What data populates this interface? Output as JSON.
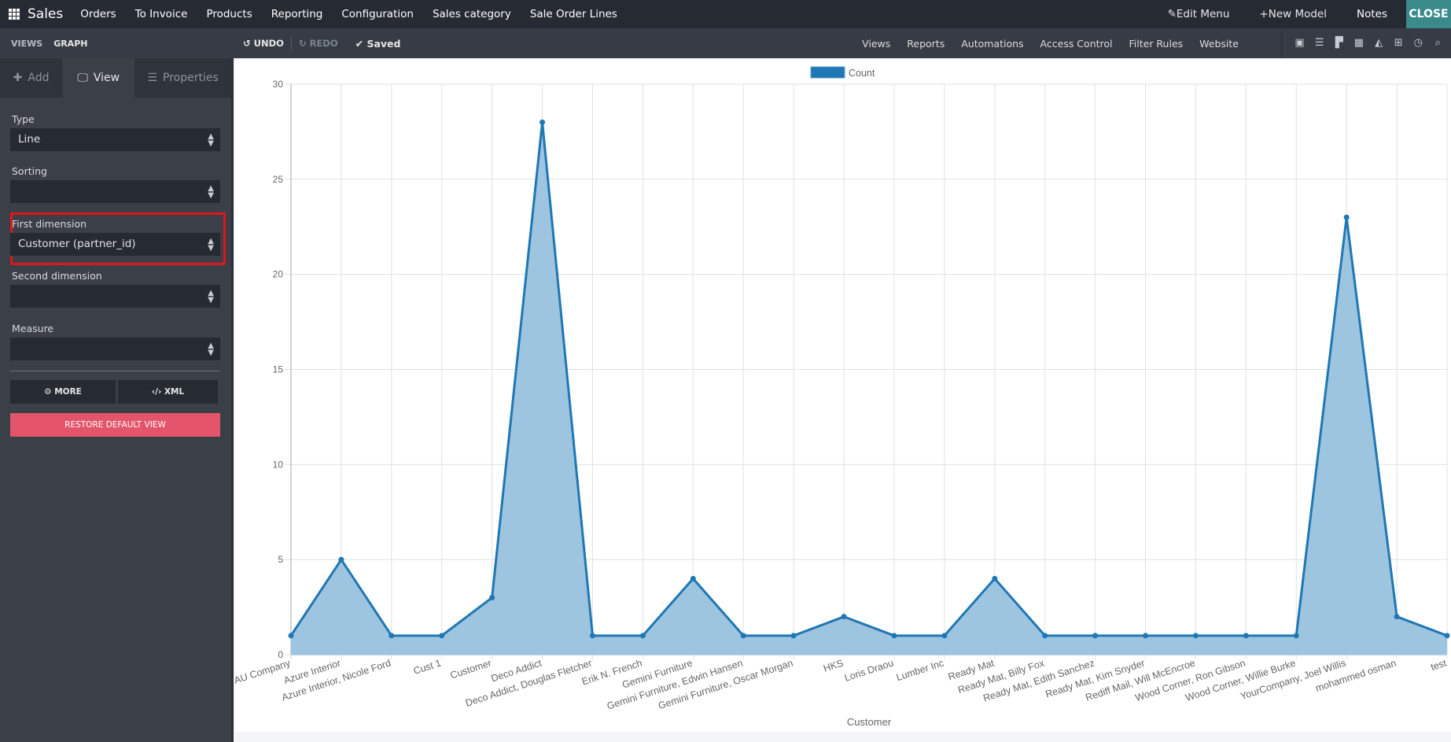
{
  "topbar": {
    "app_name": "Sales",
    "menu": [
      "Orders",
      "To Invoice",
      "Products",
      "Reporting",
      "Configuration",
      "Sales category",
      "Sale Order Lines"
    ],
    "edit_menu": "Edit Menu",
    "new_model": "New Model",
    "notes": "Notes",
    "close": "CLOSE"
  },
  "subbar": {
    "breadcrumb": [
      "VIEWS",
      "GRAPH"
    ],
    "undo": "UNDO",
    "redo": "REDO",
    "saved": "Saved",
    "links": [
      "Views",
      "Reports",
      "Automations",
      "Access Control",
      "Filter Rules",
      "Website"
    ],
    "view_icons": [
      "form-view-icon",
      "list-view-icon",
      "kanban-view-icon",
      "calendar-view-icon",
      "graph-view-icon",
      "pivot-view-icon",
      "activity-view-icon",
      "search-view-icon"
    ]
  },
  "sidebar": {
    "tabs": [
      {
        "label": "Add",
        "icon": "plus-icon"
      },
      {
        "label": "View",
        "icon": "monitor-icon",
        "active": true
      },
      {
        "label": "Properties",
        "icon": "server-icon"
      }
    ],
    "fields": {
      "type": {
        "label": "Type",
        "value": "Line"
      },
      "sorting": {
        "label": "Sorting",
        "value": ""
      },
      "first_dimension": {
        "label": "First dimension",
        "value": "Customer (partner_id)"
      },
      "second_dimension": {
        "label": "Second dimension",
        "value": ""
      },
      "measure": {
        "label": "Measure",
        "value": ""
      }
    },
    "more": "MORE",
    "xml": "XML",
    "restore": "RESTORE DEFAULT VIEW"
  },
  "colors": {
    "line": "#1f77b4",
    "fill": "#9ec5e0",
    "highlight": "#e0161c",
    "restore_button": "#e4546a",
    "close_button": "#3a8a8c"
  },
  "chart_data": {
    "type": "line",
    "title": "",
    "legend": {
      "entries": [
        "Count"
      ],
      "position": "top-center"
    },
    "xlabel": "Customer",
    "ylabel": "",
    "ylim": [
      0,
      30
    ],
    "yticks": [
      0,
      5,
      10,
      15,
      20,
      25,
      30
    ],
    "grid": true,
    "filled": true,
    "categories": [
      "AU Company",
      "Azure Interior",
      "Azure Interior, Nicole Ford",
      "Cust 1",
      "Customer",
      "Deco Addict",
      "Deco Addict, Douglas Fletcher",
      "Erik N. French",
      "Gemini Furniture",
      "Gemini Furniture, Edwin Hansen",
      "Gemini Furniture, Oscar Morgan",
      "HKS",
      "Loris Draou",
      "Lumber Inc",
      "Ready Mat",
      "Ready Mat, Billy Fox",
      "Ready Mat, Edith Sanchez",
      "Ready Mat, Kim Snyder",
      "Rediff Mail, Will McEncroe",
      "Wood Corner, Ron Gibson",
      "Wood Corner, Willie Burke",
      "YourCompany, Joel Willis",
      "mohammed osman",
      "test"
    ],
    "series": [
      {
        "name": "Count",
        "values": [
          1,
          5,
          1,
          1,
          3,
          28,
          1,
          1,
          4,
          1,
          1,
          2,
          1,
          1,
          4,
          1,
          1,
          1,
          1,
          1,
          1,
          23,
          2,
          1
        ]
      }
    ]
  }
}
